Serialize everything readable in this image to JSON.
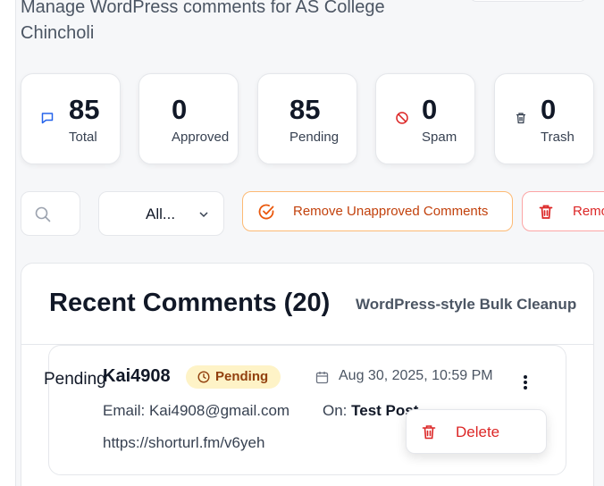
{
  "header": {
    "subtitle": "Manage WordPress comments for AS College Chincholi"
  },
  "stats": [
    {
      "value": "85",
      "label": "Total",
      "icon": "message-icon",
      "color": "#2563eb"
    },
    {
      "value": "0",
      "label": "Approved"
    },
    {
      "value": "85",
      "label": "Pending"
    },
    {
      "value": "0",
      "label": "Spam",
      "icon": "ban-icon",
      "color": "#dc2626"
    },
    {
      "value": "0",
      "label": "Trash",
      "icon": "trash-icon",
      "color": "#374151"
    }
  ],
  "toolbar": {
    "search_icon": "search-icon",
    "filter_value": "All...",
    "remove_unapproved_label": "Remove Unapproved Comments",
    "remove_spam_label": "Remo"
  },
  "panel": {
    "title": "Recent Comments (20)",
    "subtitle": "WordPress-style Bulk Cleanup"
  },
  "comment": {
    "overlay_status": "Pending",
    "author": "Kai4908",
    "status": "Pending",
    "date": "Aug 30, 2025, 10:59 PM",
    "email": "Email: Kai4908@gmail.com",
    "on_label": "On:",
    "post": "Test Post",
    "url": "https://shorturl.fm/v6yeh"
  },
  "menu": {
    "delete_label": "Delete"
  },
  "colors": {
    "accent_orange": "#ea580c",
    "danger": "#dc2626",
    "pending_bg": "#fef3c7"
  }
}
